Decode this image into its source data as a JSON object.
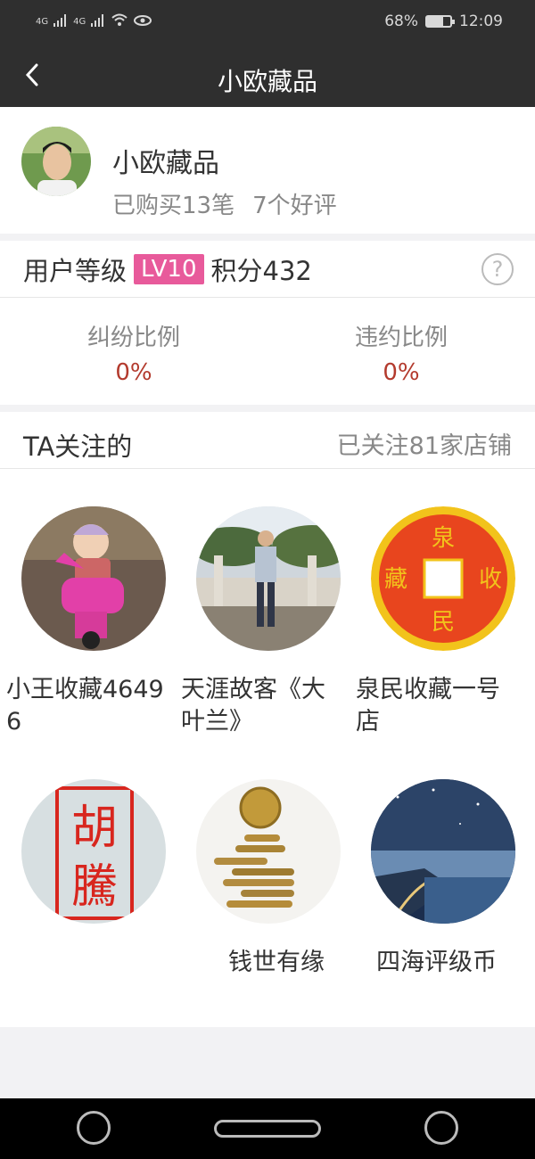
{
  "status": {
    "signal_a": "4G",
    "signal_b": "4G",
    "battery": "68%",
    "battery_level": 0.68,
    "time": "12:09"
  },
  "nav": {
    "title": "小欧藏品"
  },
  "profile": {
    "name": "小欧藏品",
    "purchases": "已购买13笔",
    "reviews": "7个好评"
  },
  "level": {
    "label": "用户等级",
    "badge": "LV10",
    "points": "积分432",
    "help": "?"
  },
  "ratios": [
    {
      "label": "纠纷比例",
      "value": "0%"
    },
    {
      "label": "违约比例",
      "value": "0%"
    }
  ],
  "follow": {
    "title": "TA关注的",
    "count": "已关注81家店铺",
    "shops": [
      {
        "name": "小王收藏46496",
        "icon": "child-on-scooter-photo"
      },
      {
        "name": "天涯故客《大叶兰》",
        "icon": "man-at-bridge-photo"
      },
      {
        "name": "泉民收藏一号店",
        "icon": "coin-emblem",
        "seal_chars": [
          "泉",
          "收",
          "民",
          "藏"
        ]
      },
      {
        "name": "",
        "icon": "red-seal-stamp",
        "seal_chars": [
          "胡",
          "騰"
        ]
      },
      {
        "name": "钱世有缘",
        "icon": "coin-stack-photo"
      },
      {
        "name": "四海评级币",
        "icon": "night-coast-photo"
      }
    ]
  },
  "colors": {
    "topbar": "#2f2f2f",
    "badge": "#e85a9b",
    "ratio_value": "#b33a2d",
    "coin_red": "#e8451e",
    "coin_gold": "#f2c31b"
  }
}
